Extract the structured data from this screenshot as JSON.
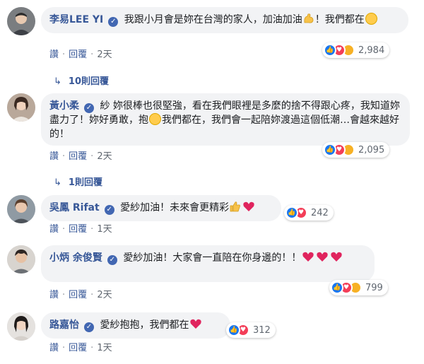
{
  "comments": [
    {
      "author": "李易LEE YI",
      "verified": true,
      "text_parts": [
        "我跟小月會是妳在台灣的家人，加油加油",
        "！我們都在"
      ],
      "reaction_count": "2,984",
      "like_label": "讚",
      "reply_label": "回覆",
      "time": "2天",
      "replies": "10則回覆"
    },
    {
      "author": "黃小柔",
      "verified": true,
      "text_parts": [
        "紗 妳很棒也很堅強，看在我們眼裡是多麼的捨不得跟心疼，我知道妳盡力了！妳好勇敢，抱",
        "我們都在，我們會一起陪妳渡過這個低潮…會越來越好的！"
      ],
      "reaction_count": "2,095",
      "like_label": "讚",
      "reply_label": "回覆",
      "time": "2天",
      "replies": "1則回覆"
    },
    {
      "author": "吳鳳 Rifat",
      "verified": true,
      "text_parts": [
        "愛紗加油！未來會更精彩"
      ],
      "reaction_count": "242",
      "like_label": "讚",
      "reply_label": "回覆",
      "time": "1天"
    },
    {
      "author": "小炳 余俊賢",
      "verified": true,
      "text_parts": [
        "愛紗加油！大家會一直陪在你身邊的！！"
      ],
      "reaction_count": "799",
      "like_label": "讚",
      "reply_label": "回覆",
      "time": "2天"
    },
    {
      "author": "路嘉怡",
      "verified": true,
      "text_parts": [
        "愛紗抱抱，我們都在"
      ],
      "reaction_count": "312",
      "like_label": "讚",
      "reply_label": "回覆",
      "time": "1天"
    }
  ],
  "colors": {
    "author": "#385898",
    "bubble": "#f2f3f5",
    "like": "#1877f2",
    "love": "#f33e58",
    "sad": "#f7b125"
  }
}
